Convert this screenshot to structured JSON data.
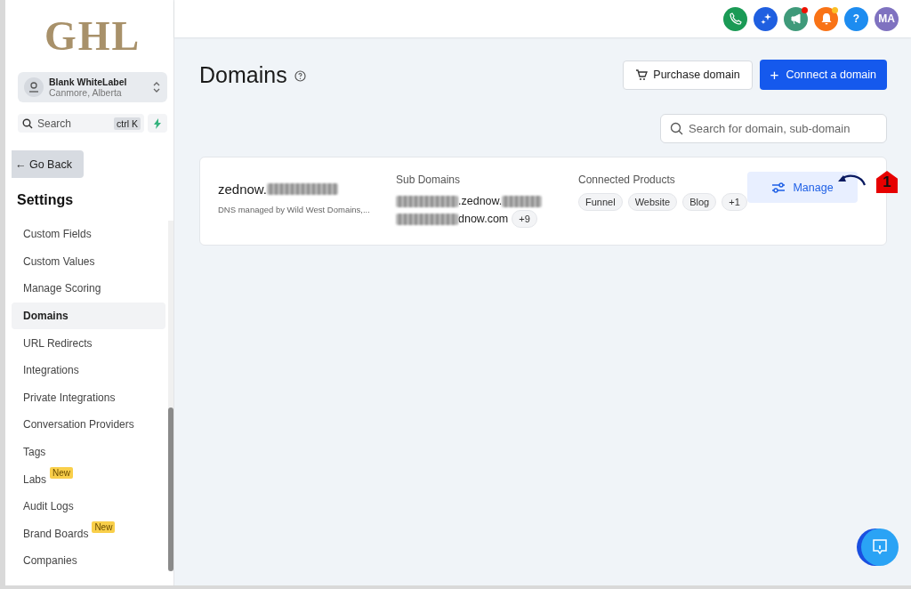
{
  "logo": "GHL",
  "account": {
    "name": "Blank WhiteLabel",
    "location": "Canmore, Alberta"
  },
  "search": {
    "placeholder": "Search",
    "shortcut": "ctrl K"
  },
  "go_back": "← Go Back",
  "sidebar": {
    "title": "Settings",
    "items": [
      {
        "label": "Custom Fields",
        "selected": false
      },
      {
        "label": "Custom Values",
        "selected": false
      },
      {
        "label": "Manage Scoring",
        "selected": false
      },
      {
        "label": "Domains",
        "selected": true
      },
      {
        "label": "URL Redirects",
        "selected": false
      },
      {
        "label": "Integrations",
        "selected": false
      },
      {
        "label": "Private Integrations",
        "selected": false
      },
      {
        "label": "Conversation Providers",
        "selected": false
      },
      {
        "label": "Tags",
        "selected": false
      },
      {
        "label": "Labs",
        "selected": false,
        "badge": "New"
      },
      {
        "label": "Audit Logs",
        "selected": false
      },
      {
        "label": "Brand Boards",
        "selected": false,
        "badge": "New"
      },
      {
        "label": "Companies",
        "selected": false
      }
    ]
  },
  "header": {
    "icons": [
      {
        "kind": "phone",
        "color": "#1a9a55",
        "dot": false
      },
      {
        "kind": "sparkle",
        "color": "#1f5fe0",
        "dot": false
      },
      {
        "kind": "megaphone",
        "color": "#3f9a7a",
        "dot": true
      },
      {
        "kind": "bell",
        "color": "#f97316",
        "dot": true
      },
      {
        "kind": "help",
        "color": "#1d8cf0",
        "dot": false,
        "text": "?"
      },
      {
        "kind": "avatar",
        "color": "#7f72c0",
        "dot": false,
        "text": "MA"
      }
    ]
  },
  "page": {
    "title": "Domains",
    "purchase_button": "Purchase domain",
    "connect_icon": "+",
    "connect_button": "Connect a domain",
    "search_placeholder": "Search for domain, sub-domain"
  },
  "domain": {
    "name": "zednow.",
    "dns": "DNS managed by Wild West Domains,...",
    "sub_domains_label": "Sub Domains",
    "sub_domains": [
      {
        "text": ".zednow."
      },
      {
        "text": "dnow.com"
      }
    ],
    "sub_more": "+9",
    "products_label": "Connected Products",
    "products": [
      "Funnel",
      "Website",
      "Blog",
      "+1"
    ],
    "manage_button": "Manage",
    "annotation": "1"
  }
}
